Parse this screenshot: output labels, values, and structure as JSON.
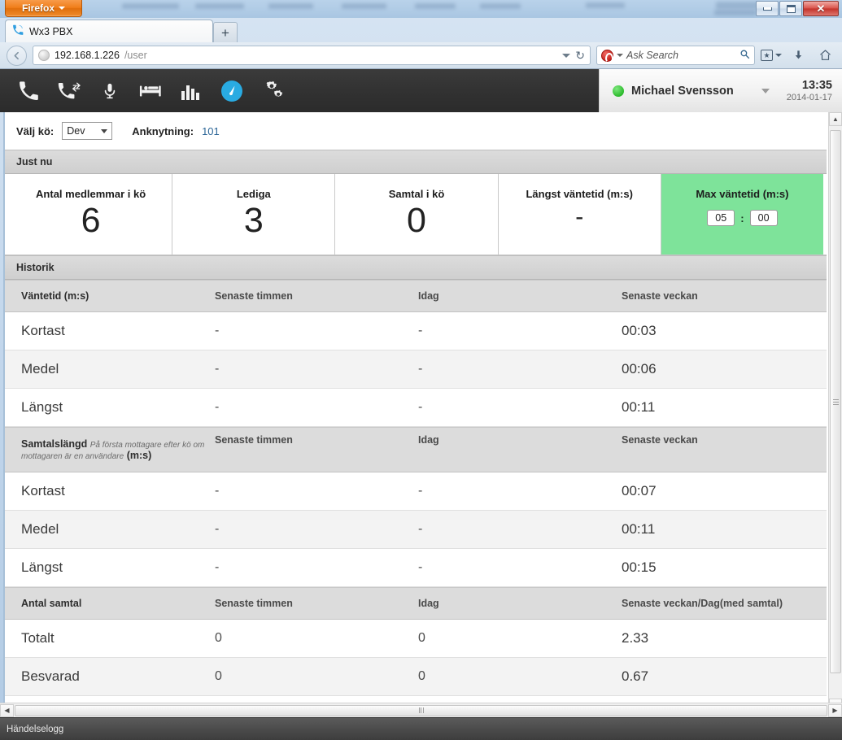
{
  "window": {
    "firefox_button": "Firefox",
    "controls": {
      "minimize": "minimize",
      "restore": "restore",
      "close": "close"
    }
  },
  "tabs": [
    {
      "title": "Wx3 PBX",
      "favicon": "phone-icon"
    }
  ],
  "new_tab_label": "+",
  "navbar": {
    "url_host": "192.168.1.226",
    "url_path": "/user",
    "reload_glyph": "↻",
    "search_placeholder": "Ask Search",
    "search_value": "",
    "search_provider": "ask-logo-icon",
    "magnifier_glyph": "⌕",
    "back_glyph": "←",
    "bookmark_glyph": "★",
    "download_glyph": "↓",
    "home_glyph": "⌂"
  },
  "app_header": {
    "icons": [
      {
        "name": "phone-icon",
        "label": "Telefoni"
      },
      {
        "name": "phone-transfer-icon",
        "label": "Samtalshantering"
      },
      {
        "name": "microphone-icon",
        "label": "Inspelning"
      },
      {
        "name": "bed-icon",
        "label": "Frånvaro"
      },
      {
        "name": "bar-chart-icon",
        "label": "Statistik"
      },
      {
        "name": "gauge-icon",
        "label": "Köstatistik"
      },
      {
        "name": "gears-icon",
        "label": "Inställningar"
      }
    ],
    "active_icon_index": 5,
    "accent_color": "#29abe2",
    "user": {
      "presence": "online",
      "presence_color": "#2dbb2d",
      "name": "Michael Svensson",
      "time": "13:35",
      "date": "2014-01-17"
    }
  },
  "page": {
    "queue_label": "Välj kö:",
    "queue_selected": "Dev",
    "queue_options": [
      "Dev"
    ],
    "extension_label": "Anknytning:",
    "extension_value": "101",
    "now_section_title": "Just nu",
    "history_section_title": "Historik",
    "stats": [
      {
        "title": "Antal medlemmar i kö",
        "value": "6",
        "highlight": false
      },
      {
        "title": "Lediga",
        "value": "3",
        "highlight": false
      },
      {
        "title": "Samtal i kö",
        "value": "0",
        "highlight": false
      },
      {
        "title": "Längst väntetid (m:s)",
        "value": "-",
        "highlight": false
      },
      {
        "title": "Max väntetid (m:s)",
        "value": "",
        "highlight": true,
        "minutes": "05",
        "seconds": "00",
        "separator": ":",
        "highlight_color": "#7ee39a"
      }
    ],
    "tables": [
      {
        "header": {
          "c0": "Väntetid (m:s)",
          "c0_note": "",
          "c0_suffix": "",
          "c1": "Senaste timmen",
          "c2": "Idag",
          "c3": "Senaste veckan"
        },
        "rows": [
          {
            "c0": "Kortast",
            "c1": "-",
            "c2": "-",
            "c3": "00:03"
          },
          {
            "c0": "Medel",
            "c1": "-",
            "c2": "-",
            "c3": "00:06"
          },
          {
            "c0": "Längst",
            "c1": "-",
            "c2": "-",
            "c3": "00:11"
          }
        ]
      },
      {
        "header": {
          "c0": "Samtalslängd",
          "c0_note": "På första mottagare efter kö om mottagaren är en användare",
          "c0_suffix": "(m:s)",
          "c1": "Senaste timmen",
          "c2": "Idag",
          "c3": "Senaste veckan"
        },
        "rows": [
          {
            "c0": "Kortast",
            "c1": "-",
            "c2": "-",
            "c3": "00:07"
          },
          {
            "c0": "Medel",
            "c1": "-",
            "c2": "-",
            "c3": "00:11"
          },
          {
            "c0": "Längst",
            "c1": "-",
            "c2": "-",
            "c3": "00:15"
          }
        ]
      },
      {
        "header": {
          "c0": "Antal samtal",
          "c0_note": "",
          "c0_suffix": "",
          "c1": "Senaste timmen",
          "c2": "Idag",
          "c3": "Senaste veckan/Dag(med samtal)"
        },
        "rows": [
          {
            "c0": "Totalt",
            "c1": "0",
            "c2": "0",
            "c3": "2.33"
          },
          {
            "c0": "Besvarad",
            "c1": "0",
            "c2": "0",
            "c3": "0.67"
          }
        ]
      }
    ]
  },
  "statusbar": {
    "text": "Händelselogg"
  }
}
